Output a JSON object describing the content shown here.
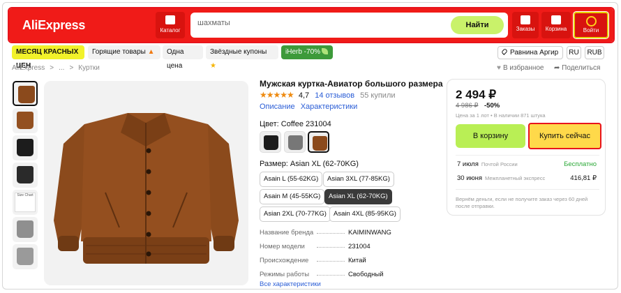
{
  "header": {
    "logo": "AliExpress",
    "catalog_label": "Каталог",
    "search_value": "шахматы",
    "search_button": "Найти",
    "orders_label": "Заказы",
    "cart_label": "Корзина",
    "login_label": "Войти",
    "accent": "#f01b18"
  },
  "promo": {
    "month": "МЕСЯЦ КРАСНЫХ ЦЕН",
    "hot": "Горящие товары",
    "one_price": "Одна цена",
    "coupons": "Звёздные купоны",
    "iherb": "iHerb -70%",
    "location": "Равнина Аргир",
    "lang": "RU",
    "currency": "RUB"
  },
  "breadcrumb": {
    "items": [
      "AliExpress",
      ">",
      "...",
      ">",
      "Куртки"
    ],
    "favorite": "В избранное",
    "share": "Поделиться"
  },
  "product": {
    "title": "Мужская куртка-Авиатор большого размера",
    "stars": "★★★★★",
    "rating": "4,7",
    "reviews": "14 отзывов",
    "sold": "55 купили",
    "tab_description": "Описание",
    "tab_specs": "Характеристики",
    "color_label": "Цвет: Coffee 231004",
    "size_label": "Размер: Asian XL (62-70KG)",
    "sizes": [
      "Asain L (55-62KG)",
      "Asian 3XL (77-85KG)",
      "Asain M (45-55KG)",
      "Asian XL (62-70KG)",
      "Asian 2XL (70-77KG)",
      "Asain 4XL (85-95KG)"
    ],
    "selected_size": "Asian XL (62-70KG)",
    "size_chart_label": "Size Chart",
    "specs": [
      {
        "k": "Название бренда",
        "v": "KAIMINWANG"
      },
      {
        "k": "Номер модели",
        "v": "231004"
      },
      {
        "k": "Происхождение",
        "v": "Китай"
      },
      {
        "k": "Режимы работы",
        "v": "Свободный"
      }
    ],
    "all_specs": "Все характеристики"
  },
  "buy": {
    "price": "2 494 ₽",
    "old_price": "4 986 ₽",
    "discount": "-50%",
    "unit_note": "Цена за 1 лот • В наличии 871 штука",
    "cart_button": "В корзину",
    "buy_now": "Купить сейчас",
    "shipping": [
      {
        "date": "7 июля",
        "method": "Почтой России",
        "price": "Бесплатно"
      },
      {
        "date": "30 июня",
        "method": "Межпланетный экспресс",
        "price": "416,81 ₽"
      }
    ],
    "refund_note": "Вернём деньги, если не получите заказ через 60 дней после отправки."
  },
  "colors": {
    "brown": "#8b4a1c",
    "black": "#1c1c1c",
    "gray": "#777777",
    "lightgray": "#8f8f8f",
    "link": "#2a5dd6",
    "lime": "#b9ef55",
    "yellow": "#ffd94a"
  }
}
